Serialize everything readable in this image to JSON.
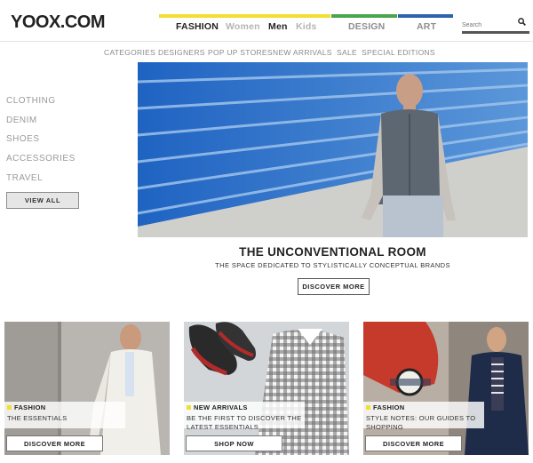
{
  "header": {
    "logo": "YOOX.COM",
    "nav": {
      "fashion": "FASHION",
      "women": "Women",
      "men": "Men",
      "kids": "Kids",
      "design": "DESIGN",
      "art": "ART"
    },
    "section_colors": {
      "fashion": "#f2df2f",
      "design": "#4aa54d",
      "art": "#2b63ad"
    },
    "search": {
      "placeholder": "Search",
      "icon": "search-icon"
    }
  },
  "subnav": {
    "items": [
      "CATEGORIES",
      "DESIGNERS",
      "POP UP STORES",
      "NEW ARRIVALS",
      "SALE",
      "SPECIAL EDITIONS"
    ]
  },
  "sidebar": {
    "items": [
      "CLOTHING",
      "DENIM",
      "SHOES",
      "ACCESSORIES",
      "TRAVEL"
    ],
    "view_all": "VIEW ALL"
  },
  "hero": {
    "title": "THE UNCONVENTIONAL ROOM",
    "subtitle": "THE SPACE DEDICATED TO STYLISTICALLY CONCEPTUAL BRANDS",
    "button": "DISCOVER MORE"
  },
  "cards": [
    {
      "tag": "FASHION",
      "desc": "THE ESSENTIALS",
      "button": "DISCOVER MORE"
    },
    {
      "tag": "NEW ARRIVALS",
      "desc": "BE THE FIRST TO DISCOVER THE LATEST ESSENTIALS",
      "button": "SHOP NOW"
    },
    {
      "tag": "FASHION",
      "desc": "STYLE NOTES: OUR GUIDES TO SHOPPING",
      "button": "DISCOVER MORE"
    }
  ]
}
